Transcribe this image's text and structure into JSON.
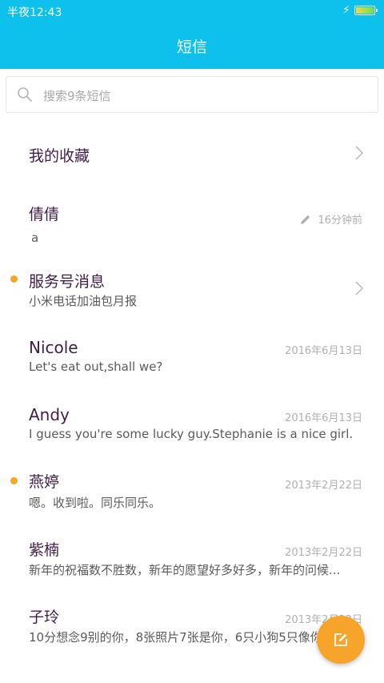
{
  "status_bar": {
    "time": "半夜12:43",
    "charging_icon": "lightning-bolt-icon",
    "battery_level": 1.0
  },
  "app_bar": {
    "title": "短信"
  },
  "search": {
    "placeholder": "搜索9条短信",
    "icon": "search-icon"
  },
  "favorites": {
    "label": "我的收藏",
    "icon": "chevron-right-icon"
  },
  "conversations": [
    {
      "name": "倩倩",
      "preview": "a",
      "time": "16分钟前",
      "draft": true
    },
    {
      "name": "服务号消息",
      "preview": "小米电话加油包月报",
      "unread": true,
      "has_chevron": true
    },
    {
      "name": "Nicole",
      "preview": "Let's eat out,shall we?",
      "time": "2016年6月13日"
    },
    {
      "name": "Andy",
      "preview": "I guess you're some lucky guy.Stephanie is a nice girl.",
      "time": "2016年6月13日"
    },
    {
      "name": "燕婷",
      "preview": "嗯。收到啦。同乐同乐。",
      "time": "2013年2月22日",
      "unread": true
    },
    {
      "name": "紫楠",
      "preview": "新年的祝福数不胜数，新年的愿望好多好多，新年的问候...",
      "time": "2013年2月22日"
    },
    {
      "name": "子玲",
      "preview": "10分想念9别的你，8张照片7张是你，6只小狗5只像你",
      "time": "2013年2月22日"
    }
  ],
  "fab": {
    "icon": "compose-icon"
  },
  "colors": {
    "accent": "#0ec1ec",
    "fab": "#f7a52a",
    "unread_dot": "#f5a623",
    "title_text": "#3f1d49"
  }
}
